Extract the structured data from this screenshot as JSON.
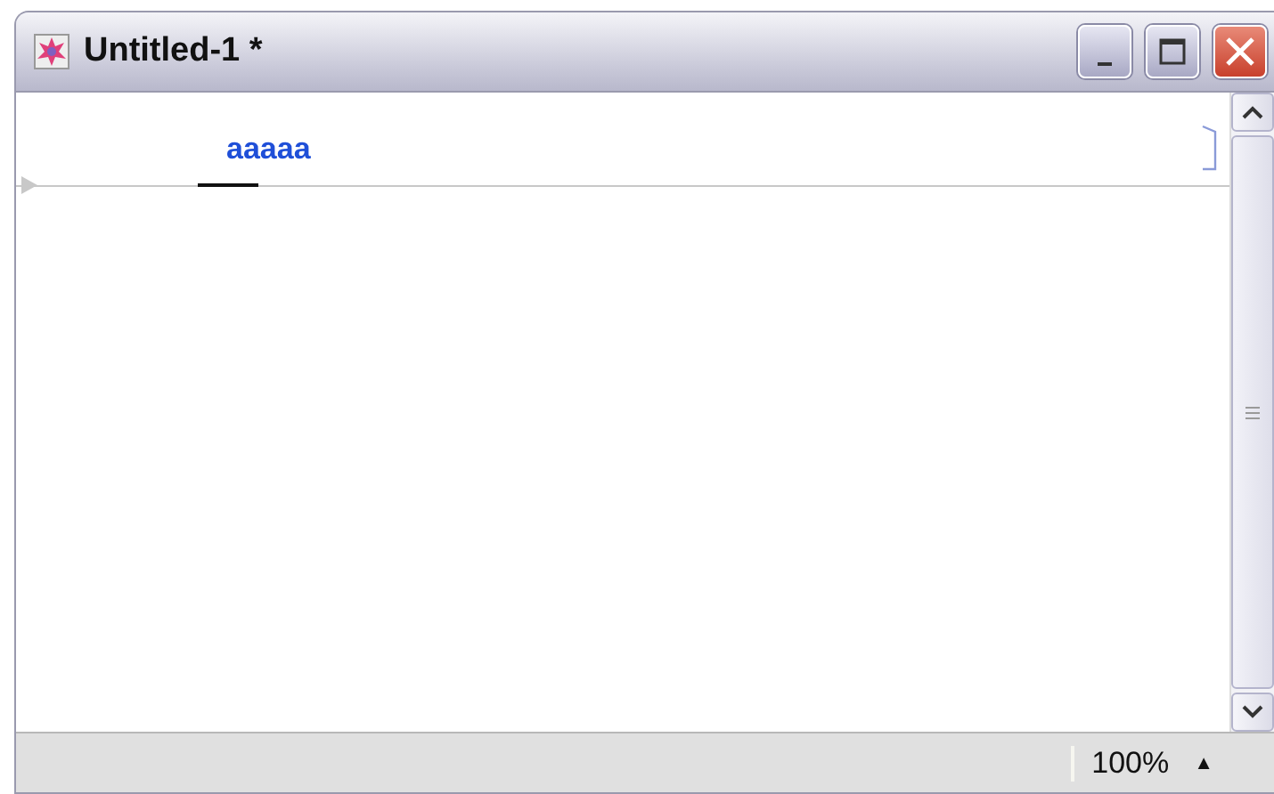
{
  "window": {
    "title": "Untitled-1 *"
  },
  "document": {
    "lyric": "aaaaa"
  },
  "status_bar": {
    "zoom": "100%",
    "zoom_arrow": "▲"
  }
}
